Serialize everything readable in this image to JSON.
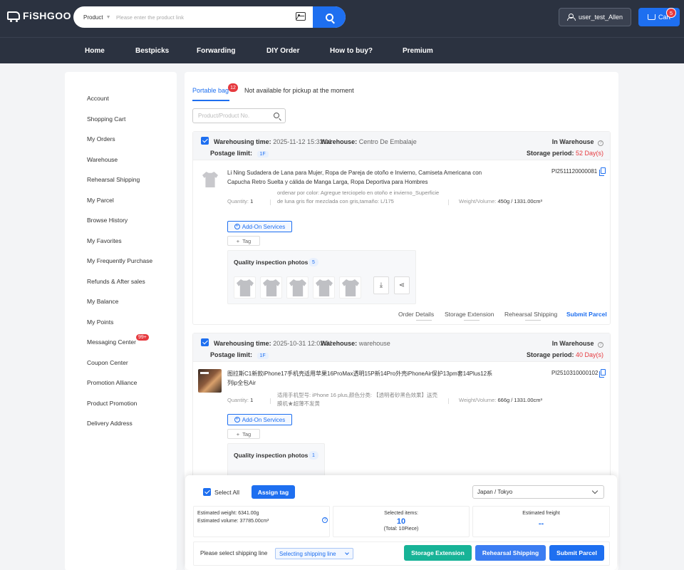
{
  "header": {
    "logo": "FiSHGOO",
    "search_type": "Product",
    "search_placeholder": "Please enter the product link",
    "user_label": "user_test_Allen",
    "cart_label": "Cart",
    "cart_count": "5"
  },
  "nav": [
    "Home",
    "Bestpicks",
    "Forwarding",
    "DIY Order",
    "How to buy?",
    "Premium"
  ],
  "sidebar": {
    "items": [
      "Account",
      "Shopping Cart",
      "My Orders",
      "Warehouse",
      "Rehearsal Shipping",
      "My Parcel",
      "Browse History",
      "My Favorites",
      "My Frequently Purchase",
      "Refunds & After sales",
      "My Balance",
      "My Points",
      "Messaging Center",
      "Coupon Center",
      "Promotion Alliance",
      "Product Promotion",
      "Delivery Address"
    ],
    "messaging_badge": "99+"
  },
  "tabs": {
    "active": "Portable bag",
    "active_count": "12",
    "other": "Not available for pickup at the moment"
  },
  "product_search_placeholder": "Product/Product No.",
  "labels": {
    "warehousing_time": "Warehousing time:",
    "warehouse": "Warehouse:",
    "postage_limit": "Postage limit:",
    "in_warehouse": "In Warehouse",
    "storage_period": "Storage period:",
    "quantity": "Quantity:",
    "weight_volume": "Weight/Volume:",
    "add_on": "Add-On Services",
    "tag": "Tag",
    "qi_photos": "Quality inspection photos",
    "order_details": "Order Details",
    "storage_extension": "Storage Extension",
    "rehearsal_shipping": "Rehearsal Shipping",
    "submit_parcel": "Submit Parcel"
  },
  "parcels": [
    {
      "warehousing_time": "2025-11-12 15:32:01",
      "warehouse": "Centro De Embalaje",
      "postage_limit": "1F",
      "storage_period": "52 Day(s)",
      "title": "Li Ning Sudadera de Lana para Mujer, Ropa de Pareja de otoño e Invierno, Camiseta Americana con Capucha Retro Suelta y cálida de Manga Larga, Ropa Deportiva para Hombres",
      "product_id": "PI2511120000081",
      "quantity": "1",
      "spec": "ordenar por color: Agregue terciopelo en otoño e invierno_Superficie de luna gris flor mezclada con gris,tamaño: L/175",
      "weight_volume": "450g / 1331.00cm³",
      "qi_count": "5"
    },
    {
      "warehousing_time": "2025-10-31 12:02:31",
      "warehouse": "warehouse",
      "postage_limit": "1F",
      "storage_period": "40 Day(s)",
      "title": "图拉斯C1新款iPhone17手机壳适用苹果16ProMax透明15P新14Pro外壳iPhoneAir保护13pm套14Plus12系列ip全包Air",
      "product_id": "PI2510310000102",
      "quantity": "1",
      "spec": "适用手机型号: iPhone 16 plus,颜色分类: 【透明者砂黑色效果】送壳膜机★超薄不发黄",
      "weight_volume": "666g / 1331.00cm³",
      "qi_count": "1"
    }
  ],
  "bottom": {
    "select_all": "Select All",
    "assign_tag": "Assign tag",
    "region": "Japan / Tokyo",
    "estimated_weight": "Estimated weight: 6341.00g",
    "estimated_volume": "Estimated volume: 37785.00cm³",
    "selected_items_label": "Selected items:",
    "selected_items_value": "10",
    "selected_items_total": "(Total: 10Piece)",
    "estimated_freight_label": "Estimated freight",
    "estimated_freight_value": "--",
    "shipping_line_prompt": "Please select shipping line",
    "shipping_line_select": "Selecting shipping line",
    "btn_storage_extension": "Storage Extension",
    "btn_rehearsal_shipping": "Rehearsal Shipping",
    "btn_submit_parcel": "Submit Parcel"
  },
  "colors": {
    "header_bg": "#2b3240",
    "accent": "#1e6ff0",
    "danger": "#e6393e",
    "teal": "#17b397"
  }
}
